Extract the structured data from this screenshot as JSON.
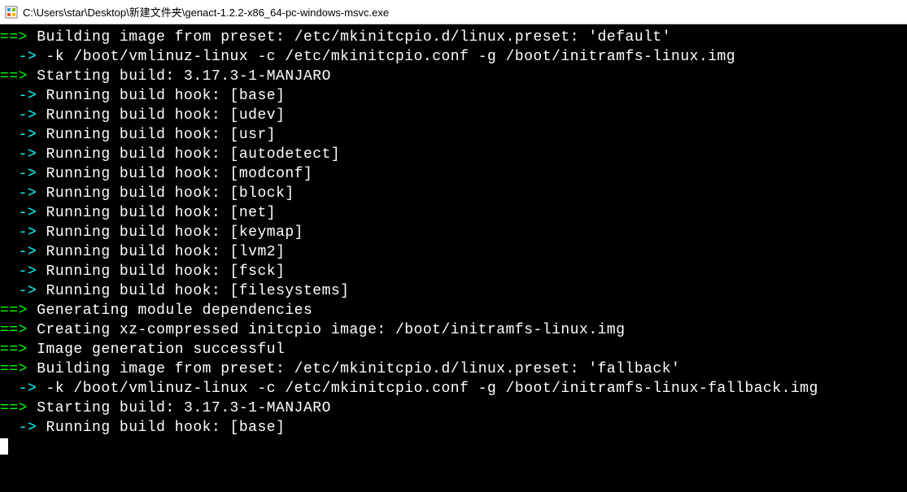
{
  "titlebar": {
    "path": "C:\\Users\\star\\Desktop\\新建文件夹\\genact-1.2.2-x86_64-pc-windows-msvc.exe"
  },
  "terminal": {
    "lines": [
      {
        "prefix": "==>",
        "prefixColor": "green",
        "text": " Building image from preset: /etc/mkinitcpio.d/linux.preset: 'default'"
      },
      {
        "prefix": "  ->",
        "prefixColor": "cyan",
        "text": " -k /boot/vmlinuz-linux -c /etc/mkinitcpio.conf -g /boot/initramfs-linux.img"
      },
      {
        "prefix": "==>",
        "prefixColor": "green",
        "text": " Starting build: 3.17.3-1-MANJARO"
      },
      {
        "prefix": "  ->",
        "prefixColor": "cyan",
        "text": " Running build hook: [base]"
      },
      {
        "prefix": "  ->",
        "prefixColor": "cyan",
        "text": " Running build hook: [udev]"
      },
      {
        "prefix": "  ->",
        "prefixColor": "cyan",
        "text": " Running build hook: [usr]"
      },
      {
        "prefix": "  ->",
        "prefixColor": "cyan",
        "text": " Running build hook: [autodetect]"
      },
      {
        "prefix": "  ->",
        "prefixColor": "cyan",
        "text": " Running build hook: [modconf]"
      },
      {
        "prefix": "  ->",
        "prefixColor": "cyan",
        "text": " Running build hook: [block]"
      },
      {
        "prefix": "  ->",
        "prefixColor": "cyan",
        "text": " Running build hook: [net]"
      },
      {
        "prefix": "  ->",
        "prefixColor": "cyan",
        "text": " Running build hook: [keymap]"
      },
      {
        "prefix": "  ->",
        "prefixColor": "cyan",
        "text": " Running build hook: [lvm2]"
      },
      {
        "prefix": "  ->",
        "prefixColor": "cyan",
        "text": " Running build hook: [fsck]"
      },
      {
        "prefix": "  ->",
        "prefixColor": "cyan",
        "text": " Running build hook: [filesystems]"
      },
      {
        "prefix": "==>",
        "prefixColor": "green",
        "text": " Generating module dependencies"
      },
      {
        "prefix": "==>",
        "prefixColor": "green",
        "text": " Creating xz-compressed initcpio image: /boot/initramfs-linux.img"
      },
      {
        "prefix": "==>",
        "prefixColor": "green",
        "text": " Image generation successful"
      },
      {
        "prefix": "==>",
        "prefixColor": "green",
        "text": " Building image from preset: /etc/mkinitcpio.d/linux.preset: 'fallback'"
      },
      {
        "prefix": "  ->",
        "prefixColor": "cyan",
        "text": " -k /boot/vmlinuz-linux -c /etc/mkinitcpio.conf -g /boot/initramfs-linux-fallback.img"
      },
      {
        "prefix": "==>",
        "prefixColor": "green",
        "text": " Starting build: 3.17.3-1-MANJARO"
      },
      {
        "prefix": "  ->",
        "prefixColor": "cyan",
        "text": " Running build hook: [base]"
      }
    ]
  }
}
